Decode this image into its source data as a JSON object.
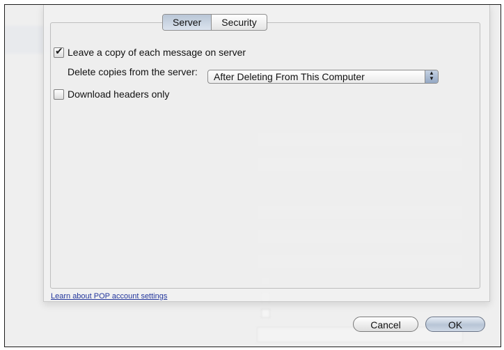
{
  "tabs": [
    {
      "label": "Server",
      "active": true
    },
    {
      "label": "Security",
      "active": false
    }
  ],
  "options": {
    "leave_copy": {
      "label": "Leave a copy of each message on server",
      "checked": true
    },
    "delete_copies": {
      "label": "Delete copies from the server:",
      "selected": "After Deleting From This Computer"
    },
    "download_headers": {
      "label": "Download headers only",
      "checked": false
    }
  },
  "link": "Learn about POP account settings",
  "buttons": {
    "cancel": "Cancel",
    "ok": "OK"
  }
}
